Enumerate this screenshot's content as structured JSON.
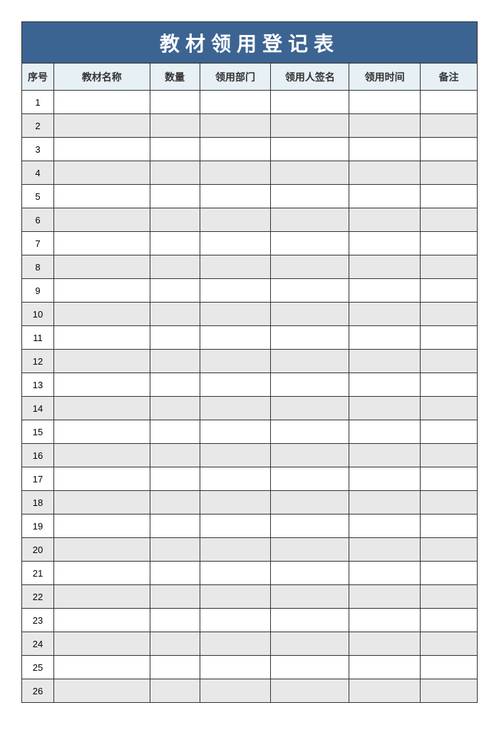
{
  "title": "教材领用登记表",
  "headers": {
    "seq": "序号",
    "name": "教材名称",
    "qty": "数量",
    "dept": "领用部门",
    "sign": "领用人签名",
    "time": "领用时间",
    "remark": "备注"
  },
  "rows": [
    {
      "seq": "1",
      "name": "",
      "qty": "",
      "dept": "",
      "sign": "",
      "time": "",
      "remark": ""
    },
    {
      "seq": "2",
      "name": "",
      "qty": "",
      "dept": "",
      "sign": "",
      "time": "",
      "remark": ""
    },
    {
      "seq": "3",
      "name": "",
      "qty": "",
      "dept": "",
      "sign": "",
      "time": "",
      "remark": ""
    },
    {
      "seq": "4",
      "name": "",
      "qty": "",
      "dept": "",
      "sign": "",
      "time": "",
      "remark": ""
    },
    {
      "seq": "5",
      "name": "",
      "qty": "",
      "dept": "",
      "sign": "",
      "time": "",
      "remark": ""
    },
    {
      "seq": "6",
      "name": "",
      "qty": "",
      "dept": "",
      "sign": "",
      "time": "",
      "remark": ""
    },
    {
      "seq": "7",
      "name": "",
      "qty": "",
      "dept": "",
      "sign": "",
      "time": "",
      "remark": ""
    },
    {
      "seq": "8",
      "name": "",
      "qty": "",
      "dept": "",
      "sign": "",
      "time": "",
      "remark": ""
    },
    {
      "seq": "9",
      "name": "",
      "qty": "",
      "dept": "",
      "sign": "",
      "time": "",
      "remark": ""
    },
    {
      "seq": "10",
      "name": "",
      "qty": "",
      "dept": "",
      "sign": "",
      "time": "",
      "remark": ""
    },
    {
      "seq": "11",
      "name": "",
      "qty": "",
      "dept": "",
      "sign": "",
      "time": "",
      "remark": ""
    },
    {
      "seq": "12",
      "name": "",
      "qty": "",
      "dept": "",
      "sign": "",
      "time": "",
      "remark": ""
    },
    {
      "seq": "13",
      "name": "",
      "qty": "",
      "dept": "",
      "sign": "",
      "time": "",
      "remark": ""
    },
    {
      "seq": "14",
      "name": "",
      "qty": "",
      "dept": "",
      "sign": "",
      "time": "",
      "remark": ""
    },
    {
      "seq": "15",
      "name": "",
      "qty": "",
      "dept": "",
      "sign": "",
      "time": "",
      "remark": ""
    },
    {
      "seq": "16",
      "name": "",
      "qty": "",
      "dept": "",
      "sign": "",
      "time": "",
      "remark": ""
    },
    {
      "seq": "17",
      "name": "",
      "qty": "",
      "dept": "",
      "sign": "",
      "time": "",
      "remark": ""
    },
    {
      "seq": "18",
      "name": "",
      "qty": "",
      "dept": "",
      "sign": "",
      "time": "",
      "remark": ""
    },
    {
      "seq": "19",
      "name": "",
      "qty": "",
      "dept": "",
      "sign": "",
      "time": "",
      "remark": ""
    },
    {
      "seq": "20",
      "name": "",
      "qty": "",
      "dept": "",
      "sign": "",
      "time": "",
      "remark": ""
    },
    {
      "seq": "21",
      "name": "",
      "qty": "",
      "dept": "",
      "sign": "",
      "time": "",
      "remark": ""
    },
    {
      "seq": "22",
      "name": "",
      "qty": "",
      "dept": "",
      "sign": "",
      "time": "",
      "remark": ""
    },
    {
      "seq": "23",
      "name": "",
      "qty": "",
      "dept": "",
      "sign": "",
      "time": "",
      "remark": ""
    },
    {
      "seq": "24",
      "name": "",
      "qty": "",
      "dept": "",
      "sign": "",
      "time": "",
      "remark": ""
    },
    {
      "seq": "25",
      "name": "",
      "qty": "",
      "dept": "",
      "sign": "",
      "time": "",
      "remark": ""
    },
    {
      "seq": "26",
      "name": "",
      "qty": "",
      "dept": "",
      "sign": "",
      "time": "",
      "remark": ""
    }
  ]
}
